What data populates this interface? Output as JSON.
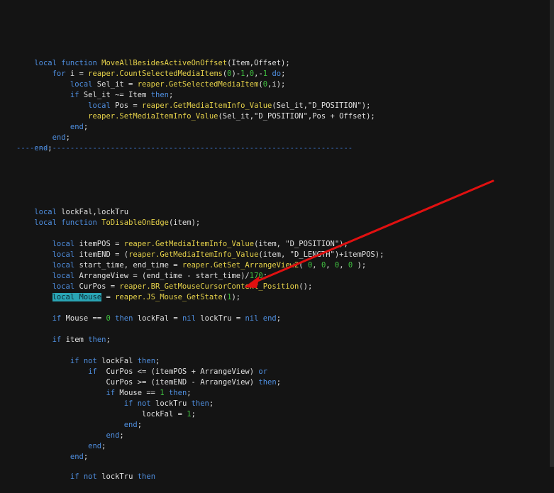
{
  "editor": {
    "separator_top": "-----------------------------------------------------------------------------------------",
    "separator_mid": "---------------------------------------------------------------------------",
    "lines": {
      "l1": [
        "local",
        " ",
        "function",
        " ",
        "MoveAllBesidesActiveOnOffset",
        "(Item,Offset);"
      ],
      "l2": [
        "    ",
        "for",
        " i = ",
        "reaper.CountSelectedMediaItems",
        "(",
        "0",
        ")-",
        "1",
        ",",
        "0",
        ",-",
        "1",
        " ",
        "do",
        ";"
      ],
      "l3": [
        "        ",
        "local",
        " Sel_it = ",
        "reaper.GetSelectedMediaItem",
        "(",
        "0",
        ",i);"
      ],
      "l4": [
        "        ",
        "if",
        " Sel_it ~= Item ",
        "then",
        ";"
      ],
      "l5": [
        "            ",
        "local",
        " Pos = ",
        "reaper.GetMediaItemInfo_Value",
        "(Sel_it,\"D_POSITION\");"
      ],
      "l6": [
        "            ",
        "reaper.SetMediaItemInfo_Value",
        "(Sel_it,\"D_POSITION\",Pos + Offset);"
      ],
      "l7": [
        "        ",
        "end",
        ";"
      ],
      "l8": [
        "    ",
        "end",
        ";"
      ],
      "l9": [
        "end",
        ";"
      ],
      "l10": [
        "local",
        " lockFal,lockTru"
      ],
      "l11": [
        "local",
        " ",
        "function",
        " ",
        "ToDisableOnEdge",
        "(item);"
      ],
      "l12": [
        "    ",
        "local",
        " itemPOS = ",
        "reaper.GetMediaItemInfo_Value",
        "(item, \"D_POSITION\");"
      ],
      "l13": [
        "    ",
        "local",
        " itemEND = (",
        "reaper.GetMediaItemInfo_Value",
        "(item, \"D_LENGTH\")+itemPOS);"
      ],
      "l14": [
        "    ",
        "local",
        " start_time, end_time = ",
        "reaper.GetSet_ArrangeView2",
        "( ",
        "0",
        ", ",
        "0",
        ", ",
        "0",
        ", ",
        "0",
        " );"
      ],
      "l15": [
        "    ",
        "local",
        " ArrangeView = (end_time - start_time)/",
        "170",
        ";"
      ],
      "l16": [
        "    ",
        "local",
        " CurPos = ",
        "reaper.BR_GetMouseCursorContext_Position",
        "();"
      ],
      "l17": [
        "    ",
        "local Mouse",
        " = ",
        "reaper.JS_Mouse_GetState",
        "(",
        "1",
        ");"
      ],
      "l18": [
        "    ",
        "if",
        " Mouse == ",
        "0",
        " ",
        "then",
        " lockFal = ",
        "nil",
        " lockTru = ",
        "nil",
        " ",
        "end",
        ";"
      ],
      "l19": [
        "    ",
        "if",
        " item ",
        "then",
        ";"
      ],
      "l20": [
        "        ",
        "if",
        " ",
        "not",
        " lockFal ",
        "then",
        ";"
      ],
      "l21": [
        "            ",
        "if",
        "  CurPos <= (itemPOS + ArrangeView) ",
        "or"
      ],
      "l22": [
        "                ",
        "CurPos >= (itemEND - ArrangeView) ",
        "then",
        ";"
      ],
      "l23": [
        "                ",
        "if",
        " Mouse == ",
        "1",
        " ",
        "then",
        ";"
      ],
      "l24": [
        "                    ",
        "if",
        " ",
        "not",
        " lockTru ",
        "then",
        ";"
      ],
      "l25": [
        "                        ",
        "lockFal = ",
        "1",
        ";"
      ],
      "l26": [
        "                    ",
        "end",
        ";"
      ],
      "l27": [
        "                ",
        "end",
        ";"
      ],
      "l28": [
        "            ",
        "end",
        ";"
      ],
      "l29": [
        "        ",
        "end",
        ";"
      ],
      "l30": [
        "        ",
        "if",
        " ",
        "not",
        " lockTru ",
        "then"
      ]
    }
  },
  "colors": {
    "background": "#141414",
    "keyword": "#4f8fe0",
    "function_name": "#e6d24a",
    "number": "#40c040",
    "comment": "#3b73c9",
    "highlight": "#2aa5b5",
    "arrow": "#e01010"
  },
  "annotation": {
    "icon": "red-arrow-icon"
  }
}
